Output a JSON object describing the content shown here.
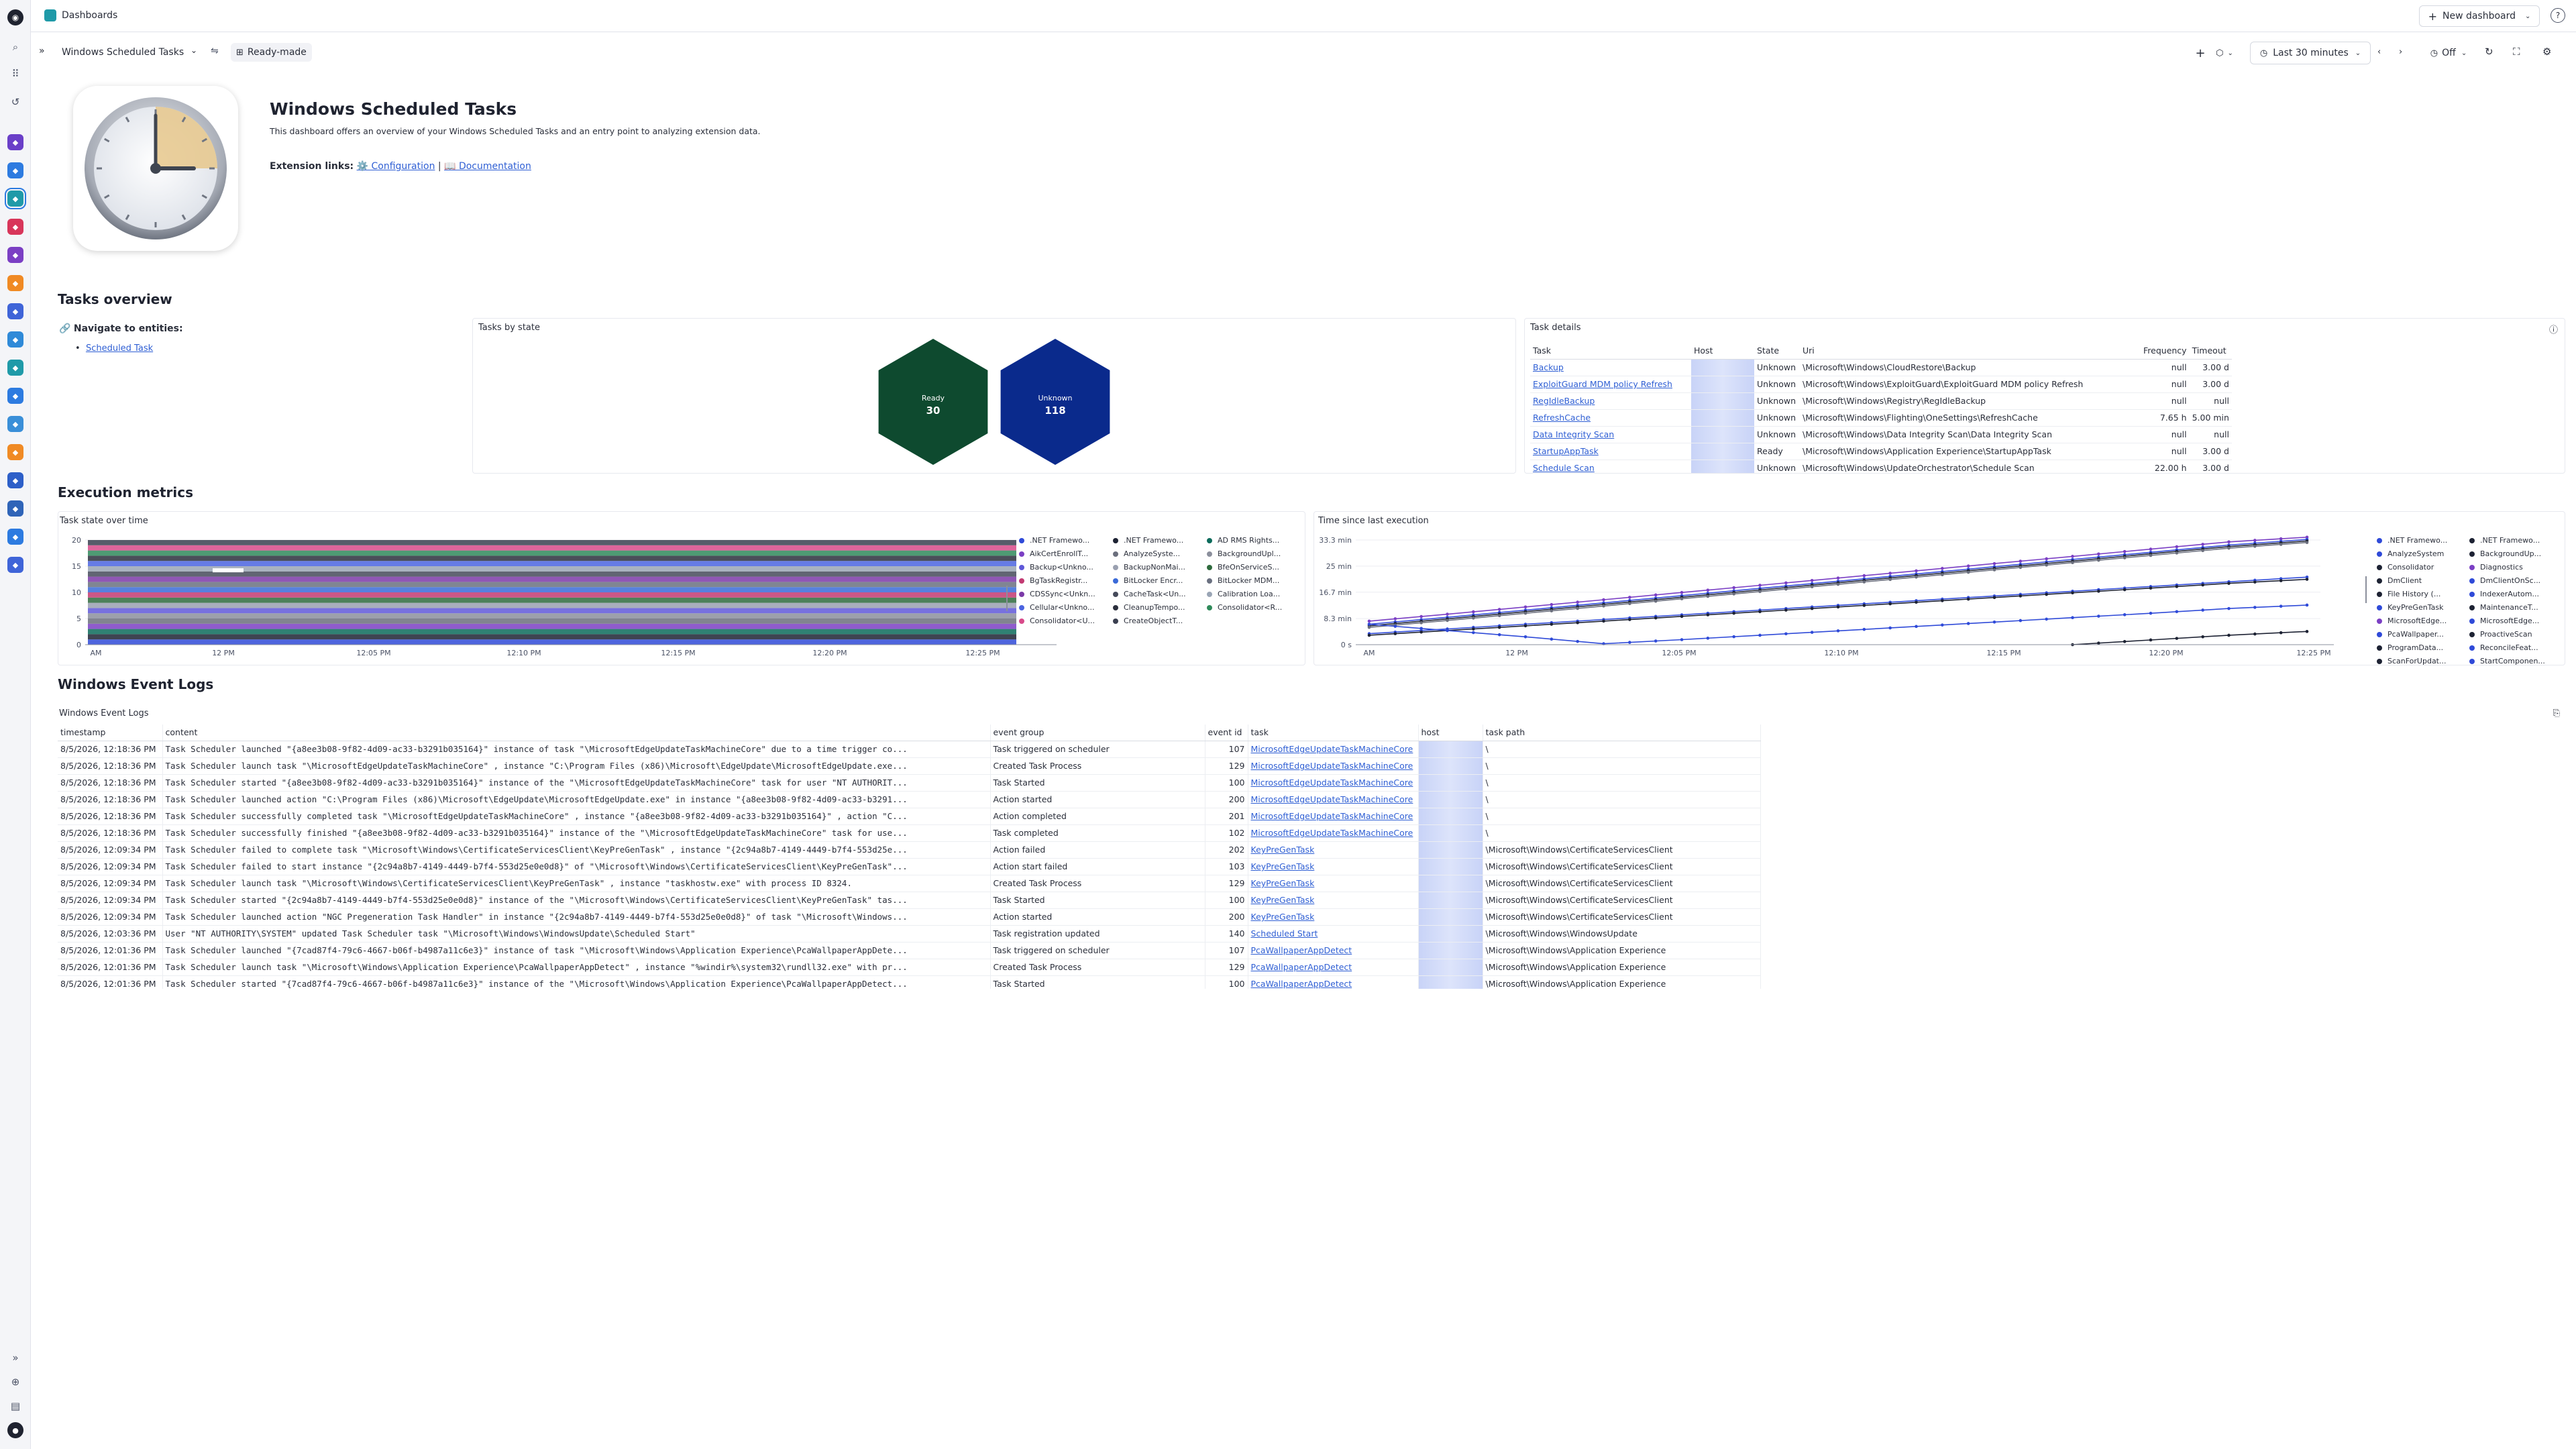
{
  "topbar": {
    "breadcrumb": "Dashboards",
    "new_dashboard_label": "New dashboard"
  },
  "dashbar": {
    "dashboard_name": "Windows Scheduled Tasks",
    "ready_made_label": "Ready-made",
    "timeframe_label": "Last 30 minutes",
    "refresh_label": "Off"
  },
  "header": {
    "title": "Windows Scheduled Tasks",
    "description": "This dashboard offers an overview of your Windows Scheduled Tasks and an entry point to analyzing extension data.",
    "links_label": "Extension links:",
    "config_link": "⚙️ Configuration",
    "separator": "|",
    "doc_link": "📖 Documentation"
  },
  "overview": {
    "section_title": "Tasks overview",
    "navigate_label": "Navigate to entities:",
    "navigate_link": "Scheduled Task",
    "tasks_by_state": {
      "title": "Tasks by state",
      "items": [
        {
          "label": "Ready",
          "value": "30",
          "color": "#0e4a2f"
        },
        {
          "label": "Unknown",
          "value": "118",
          "color": "#0a2a8c"
        }
      ]
    },
    "task_details": {
      "title": "Task details",
      "columns": [
        "Task",
        "Host",
        "State",
        "Uri",
        "Frequency",
        "Timeout"
      ],
      "rows": [
        {
          "task": "Backup",
          "state": "Unknown",
          "uri": "\\Microsoft\\Windows\\CloudRestore\\Backup",
          "frequency": "null",
          "timeout": "3.00 d"
        },
        {
          "task": "ExploitGuard MDM policy Refresh",
          "state": "Unknown",
          "uri": "\\Microsoft\\Windows\\ExploitGuard\\ExploitGuard MDM policy Refresh",
          "frequency": "null",
          "timeout": "3.00 d"
        },
        {
          "task": "RegIdleBackup",
          "state": "Unknown",
          "uri": "\\Microsoft\\Windows\\Registry\\RegIdleBackup",
          "frequency": "null",
          "timeout": "null"
        },
        {
          "task": "RefreshCache",
          "state": "Unknown",
          "uri": "\\Microsoft\\Windows\\Flighting\\OneSettings\\RefreshCache",
          "frequency": "7.65 h",
          "timeout": "5.00 min"
        },
        {
          "task": "Data Integrity Scan",
          "state": "Unknown",
          "uri": "\\Microsoft\\Windows\\Data Integrity Scan\\Data Integrity Scan",
          "frequency": "null",
          "timeout": "null"
        },
        {
          "task": "StartupAppTask",
          "state": "Ready",
          "uri": "\\Microsoft\\Windows\\Application Experience\\StartupAppTask",
          "frequency": "null",
          "timeout": "3.00 d"
        },
        {
          "task": "Schedule Scan",
          "state": "Unknown",
          "uri": "\\Microsoft\\Windows\\UpdateOrchestrator\\Schedule Scan",
          "frequency": "22.00 h",
          "timeout": "3.00 d"
        }
      ]
    }
  },
  "metrics": {
    "section_title": "Execution metrics",
    "task_state_title": "Task state over time",
    "time_since_title": "Time since last execution"
  },
  "chart_data": [
    {
      "type": "area",
      "title": "Task state over time",
      "x": [
        "AM",
        "12 PM",
        "12:05 PM",
        "12:10 PM",
        "12:15 PM",
        "12:20 PM",
        "12:25 PM"
      ],
      "y_ticks": [
        "0",
        "5",
        "10",
        "15",
        "20"
      ],
      "ylim": [
        0,
        20
      ],
      "series_count": 20,
      "stack_total": 20,
      "legend": [
        ".NET Framewo...",
        ".NET Framewo...",
        "AD RMS Rights...",
        "AikCertEnrollT...",
        "AnalyzeSyste...",
        "BackgroundUpl...",
        "Backup<Unkno...",
        "BackupNonMai...",
        "BfeOnServiceS...",
        "BgTaskRegistr...",
        "BitLocker Encr...",
        "BitLocker MDM...",
        "CDSSync<Unkn...",
        "CacheTask<Un...",
        "Calibration Loa...",
        "Cellular<Unkno...",
        "CleanupTempo...",
        "Consolidator<R...",
        "Consolidator<U...",
        "CreateObjectT..."
      ],
      "colors": [
        "#2f4ad8",
        "#1d2233",
        "#0c6b5b",
        "#7b3fc4",
        "#6b6f7d",
        "#8b8f9c",
        "#5f58d8",
        "#9aa0b0",
        "#2e6a3d",
        "#c23a72",
        "#3a6ad8",
        "#6a7080",
        "#7b3aa8",
        "#454a5a",
        "#9aa5b5",
        "#4b64e0",
        "#2b2f3d",
        "#2f8a5a",
        "#d84a8a",
        "#3a3f50"
      ]
    },
    {
      "type": "line",
      "title": "Time since last execution",
      "x": [
        "AM",
        "12 PM",
        "12:05 PM",
        "12:10 PM",
        "12:15 PM",
        "12:20 PM",
        "12:25 PM"
      ],
      "y_ticks": [
        "0 s",
        "8.3 min",
        "16.7 min",
        "25 min",
        "33.3 min"
      ],
      "ylim": [
        0,
        33.3
      ],
      "series": [
        {
          "values": [
            7.5,
            9.7,
            12,
            14.3,
            16.6,
            18.9,
            21.2,
            23.5,
            25.8,
            28.1,
            30.4,
            32.7,
            34.2
          ]
        },
        {
          "values": [
            6.5,
            8.7,
            11,
            13.3,
            15.6,
            17.9,
            20.2,
            22.5,
            24.8,
            27.1,
            29.4,
            31.7,
            33.5
          ]
        },
        {
          "values": [
            6,
            8.2,
            10.5,
            12.8,
            15.1,
            17.4,
            19.7,
            22,
            24.3,
            26.6,
            28.9,
            31.2,
            33
          ]
        },
        {
          "values": [
            5.5,
            7.7,
            10,
            12.3,
            14.6,
            16.9,
            19.2,
            21.5,
            23.8,
            26.1,
            28.4,
            30.7,
            32.5
          ]
        },
        {
          "values": [
            3.5,
            5,
            6.5,
            8,
            9.5,
            11,
            12.5,
            14,
            15.5,
            17,
            18.5,
            20,
            21.5
          ]
        },
        {
          "values": [
            3,
            4.5,
            6,
            7.5,
            9,
            10.5,
            12,
            13.5,
            15,
            16.5,
            18,
            19.5,
            20.8
          ]
        },
        {
          "values": [
            6.5,
            4.5,
            2.5,
            0.3,
            1.6,
            3,
            4.4,
            5.8,
            7.2,
            8.6,
            10,
            11.5,
            12.6
          ]
        },
        {
          "values": [
            null,
            null,
            null,
            null,
            null,
            null,
            null,
            null,
            null,
            0,
            1.5,
            3,
            4.2
          ]
        }
      ],
      "legend": [
        ".NET Framewo...",
        ".NET Framewo...",
        "AnalyzeSystem",
        "BackgroundUp...",
        "Consolidator",
        "Diagnostics",
        "DmClient",
        "DmClientOnSc...",
        "File History (...",
        "IndexerAutom...",
        "KeyPreGenTask",
        "MaintenanceT...",
        "MicrosoftEdge...",
        "MicrosoftEdge...",
        "PcaWallpaper...",
        "ProactiveScan",
        "ProgramData...",
        "ReconcileFeat...",
        "ScanForUpdat...",
        "StartComponen..."
      ],
      "colors": [
        "#2f4ad8",
        "#1d2233",
        "#2f4ad8",
        "#1d2233",
        "#1d2233",
        "#7b3fc4",
        "#1d2233",
        "#2f4ad8",
        "#1d2233",
        "#2f4ad8",
        "#2f4ad8",
        "#1d2233",
        "#7b3fc4",
        "#2f4ad8",
        "#2f4ad8",
        "#1d2233",
        "#1d2233",
        "#2f4ad8",
        "#1d2233",
        "#2f4ad8"
      ]
    }
  ],
  "logs": {
    "section_title": "Windows Event Logs",
    "panel_title": "Windows Event Logs",
    "columns": [
      "timestamp",
      "content",
      "event group",
      "event id",
      "task",
      "host",
      "task path"
    ],
    "rows": [
      {
        "ts": "8/5/2026, 12:18:36 PM",
        "content": "Task Scheduler launched \"{a8ee3b08-9f82-4d09-ac33-b3291b035164}\" instance of task \"\\MicrosoftEdgeUpdateTaskMachineCore\" due to a time trigger co...",
        "group": "Task triggered on scheduler",
        "id": "107",
        "task": "MicrosoftEdgeUpdateTaskMachineCore",
        "path": "\\"
      },
      {
        "ts": "8/5/2026, 12:18:36 PM",
        "content": "Task Scheduler launch task \"\\MicrosoftEdgeUpdateTaskMachineCore\" , instance \"C:\\Program Files (x86)\\Microsoft\\EdgeUpdate\\MicrosoftEdgeUpdate.exe...",
        "group": "Created Task Process",
        "id": "129",
        "task": "MicrosoftEdgeUpdateTaskMachineCore",
        "path": "\\"
      },
      {
        "ts": "8/5/2026, 12:18:36 PM",
        "content": "Task Scheduler started \"{a8ee3b08-9f82-4d09-ac33-b3291b035164}\" instance of the \"\\MicrosoftEdgeUpdateTaskMachineCore\" task for user \"NT AUTHORIT...",
        "group": "Task Started",
        "id": "100",
        "task": "MicrosoftEdgeUpdateTaskMachineCore",
        "path": "\\"
      },
      {
        "ts": "8/5/2026, 12:18:36 PM",
        "content": "Task Scheduler launched action \"C:\\Program Files (x86)\\Microsoft\\EdgeUpdate\\MicrosoftEdgeUpdate.exe\" in instance \"{a8ee3b08-9f82-4d09-ac33-b3291...",
        "group": "Action started",
        "id": "200",
        "task": "MicrosoftEdgeUpdateTaskMachineCore",
        "path": "\\"
      },
      {
        "ts": "8/5/2026, 12:18:36 PM",
        "content": "Task Scheduler successfully completed task \"\\MicrosoftEdgeUpdateTaskMachineCore\" , instance \"{a8ee3b08-9f82-4d09-ac33-b3291b035164}\" , action \"C...",
        "group": "Action completed",
        "id": "201",
        "task": "MicrosoftEdgeUpdateTaskMachineCore",
        "path": "\\"
      },
      {
        "ts": "8/5/2026, 12:18:36 PM",
        "content": "Task Scheduler successfully finished \"{a8ee3b08-9f82-4d09-ac33-b3291b035164}\" instance of the \"\\MicrosoftEdgeUpdateTaskMachineCore\" task for use...",
        "group": "Task completed",
        "id": "102",
        "task": "MicrosoftEdgeUpdateTaskMachineCore",
        "path": "\\"
      },
      {
        "ts": "8/5/2026, 12:09:34 PM",
        "content": "Task Scheduler failed to complete task \"\\Microsoft\\Windows\\CertificateServicesClient\\KeyPreGenTask\" , instance \"{2c94a8b7-4149-4449-b7f4-553d25e...",
        "group": "Action failed",
        "id": "202",
        "task": "KeyPreGenTask",
        "path": "\\Microsoft\\Windows\\CertificateServicesClient"
      },
      {
        "ts": "8/5/2026, 12:09:34 PM",
        "content": "Task Scheduler failed to start instance \"{2c94a8b7-4149-4449-b7f4-553d25e0e0d8}\" of \"\\Microsoft\\Windows\\CertificateServicesClient\\KeyPreGenTask\"...",
        "group": "Action start failed",
        "id": "103",
        "task": "KeyPreGenTask",
        "path": "\\Microsoft\\Windows\\CertificateServicesClient"
      },
      {
        "ts": "8/5/2026, 12:09:34 PM",
        "content": "Task Scheduler launch task \"\\Microsoft\\Windows\\CertificateServicesClient\\KeyPreGenTask\" , instance \"taskhostw.exe\" with process ID 8324.",
        "group": "Created Task Process",
        "id": "129",
        "task": "KeyPreGenTask",
        "path": "\\Microsoft\\Windows\\CertificateServicesClient"
      },
      {
        "ts": "8/5/2026, 12:09:34 PM",
        "content": "Task Scheduler started \"{2c94a8b7-4149-4449-b7f4-553d25e0e0d8}\" instance of the \"\\Microsoft\\Windows\\CertificateServicesClient\\KeyPreGenTask\" tas...",
        "group": "Task Started",
        "id": "100",
        "task": "KeyPreGenTask",
        "path": "\\Microsoft\\Windows\\CertificateServicesClient"
      },
      {
        "ts": "8/5/2026, 12:09:34 PM",
        "content": "Task Scheduler launched action \"NGC Pregeneration Task Handler\" in instance \"{2c94a8b7-4149-4449-b7f4-553d25e0e0d8}\" of task \"\\Microsoft\\Windows...",
        "group": "Action started",
        "id": "200",
        "task": "KeyPreGenTask",
        "path": "\\Microsoft\\Windows\\CertificateServicesClient"
      },
      {
        "ts": "8/5/2026, 12:03:36 PM",
        "content": "User \"NT AUTHORITY\\SYSTEM\" updated Task Scheduler task \"\\Microsoft\\Windows\\WindowsUpdate\\Scheduled Start\"",
        "group": "Task registration updated",
        "id": "140",
        "task": "Scheduled Start",
        "path": "\\Microsoft\\Windows\\WindowsUpdate"
      },
      {
        "ts": "8/5/2026, 12:01:36 PM",
        "content": "Task Scheduler launched \"{7cad87f4-79c6-4667-b06f-b4987a11c6e3}\" instance of task \"\\Microsoft\\Windows\\Application Experience\\PcaWallpaperAppDete...",
        "group": "Task triggered on scheduler",
        "id": "107",
        "task": "PcaWallpaperAppDetect",
        "path": "\\Microsoft\\Windows\\Application Experience"
      },
      {
        "ts": "8/5/2026, 12:01:36 PM",
        "content": "Task Scheduler launch task \"\\Microsoft\\Windows\\Application Experience\\PcaWallpaperAppDetect\" , instance \"%windir%\\system32\\rundll32.exe\" with pr...",
        "group": "Created Task Process",
        "id": "129",
        "task": "PcaWallpaperAppDetect",
        "path": "\\Microsoft\\Windows\\Application Experience"
      },
      {
        "ts": "8/5/2026, 12:01:36 PM",
        "content": "Task Scheduler started \"{7cad87f4-79c6-4667-b06f-b4987a11c6e3}\" instance of the \"\\Microsoft\\Windows\\Application Experience\\PcaWallpaperAppDetect...",
        "group": "Task Started",
        "id": "100",
        "task": "PcaWallpaperAppDetect",
        "path": "\\Microsoft\\Windows\\Application Experience"
      }
    ]
  },
  "icons": {
    "rail": [
      "logo-icon",
      "search-icon",
      "apps-icon",
      "history-icon"
    ],
    "apps": [
      {
        "name": "app-icon-1",
        "color": "#6a3fc8"
      },
      {
        "name": "app-icon-2",
        "color": "#2d7be0"
      },
      {
        "name": "dashboards-app-icon",
        "color": "#1f9aa8"
      },
      {
        "name": "app-icon-4",
        "color": "#d8365a"
      },
      {
        "name": "app-icon-5",
        "color": "#7b3fc4"
      },
      {
        "name": "app-icon-6",
        "color": "#f08a24"
      },
      {
        "name": "app-icon-7",
        "color": "#3f64d8"
      },
      {
        "name": "app-icon-8",
        "color": "#2f8ad8"
      },
      {
        "name": "app-icon-9",
        "color": "#1f9aa8"
      },
      {
        "name": "app-icon-10",
        "color": "#2d7be0"
      },
      {
        "name": "app-icon-11",
        "color": "#3a8fd8"
      },
      {
        "name": "app-icon-12",
        "color": "#f08a24"
      },
      {
        "name": "app-icon-13",
        "color": "#2d5fc8"
      },
      {
        "name": "app-icon-14",
        "color": "#2f64b8"
      },
      {
        "name": "app-icon-15",
        "color": "#2d7be0"
      },
      {
        "name": "app-icon-16",
        "color": "#3f64d8"
      }
    ]
  }
}
